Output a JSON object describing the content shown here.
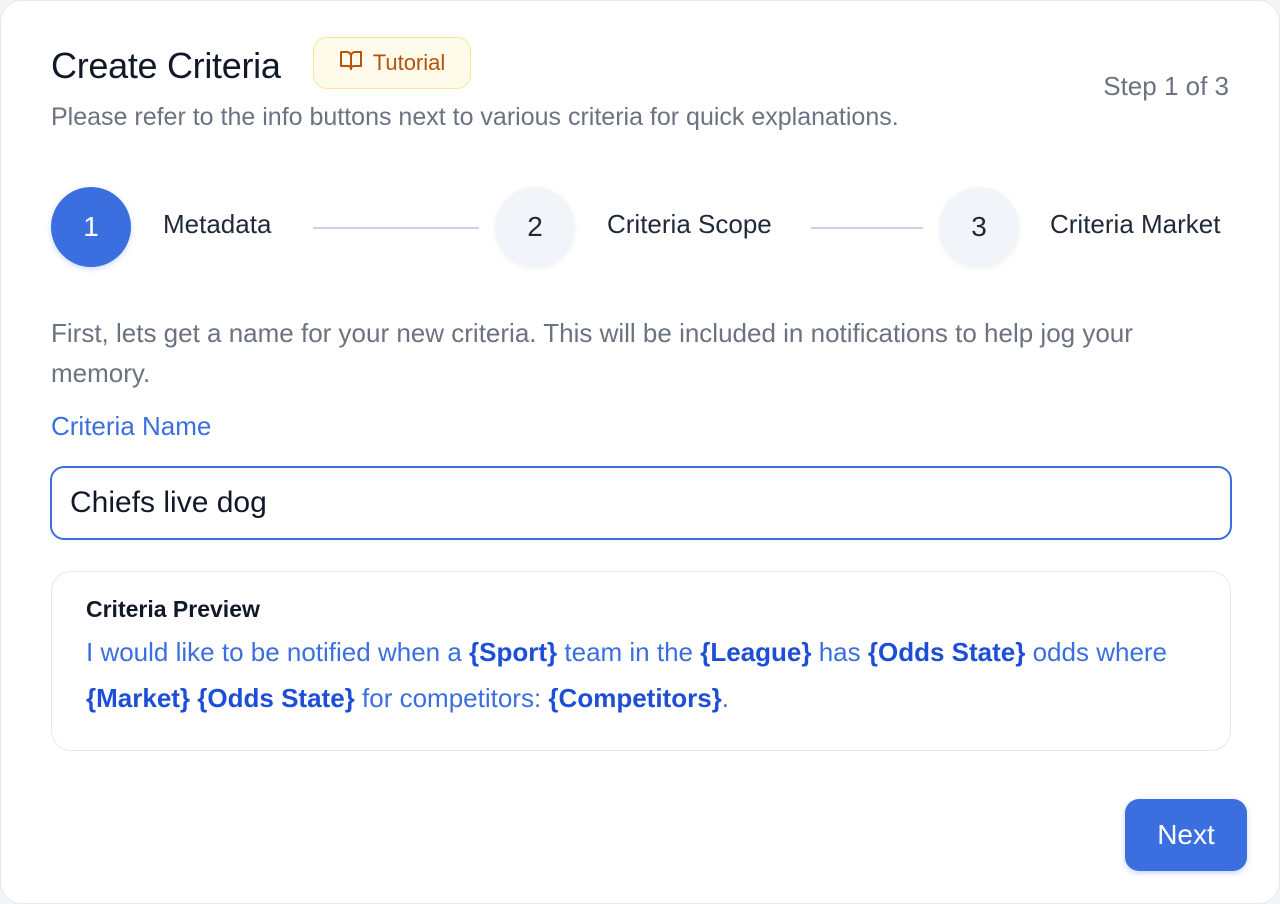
{
  "header": {
    "title": "Create Criteria",
    "tutorial_label": "Tutorial",
    "tutorial_icon": "book-open-icon",
    "step_indicator": "Step 1 of 3",
    "subtitle": "Please refer to the info buttons next to various criteria for quick explanations."
  },
  "stepper": {
    "steps": [
      {
        "number": "1",
        "label": "Metadata",
        "state": "active"
      },
      {
        "number": "2",
        "label": "Criteria Scope",
        "state": "inactive"
      },
      {
        "number": "3",
        "label": "Criteria Market",
        "state": "inactive"
      }
    ]
  },
  "form": {
    "intro": "First, lets get a name for your new criteria. This will be included in notifications to help jog your memory.",
    "name_label": "Criteria Name",
    "name_value": "Chiefs live dog"
  },
  "preview": {
    "title": "Criteria Preview",
    "segments": [
      {
        "text": "I would like to be notified when a ",
        "token": false
      },
      {
        "text": "{Sport}",
        "token": true
      },
      {
        "text": " team in the ",
        "token": false
      },
      {
        "text": "{League}",
        "token": true
      },
      {
        "text": " has ",
        "token": false
      },
      {
        "text": "{Odds State}",
        "token": true
      },
      {
        "text": " odds where ",
        "token": false
      },
      {
        "text": "{Market}",
        "token": true
      },
      {
        "text": " ",
        "token": false
      },
      {
        "text": "{Odds State}",
        "token": true
      },
      {
        "text": " for competitors: ",
        "token": false
      },
      {
        "text": "{Competitors}",
        "token": true
      },
      {
        "text": ".",
        "token": false
      }
    ]
  },
  "actions": {
    "next_label": "Next"
  },
  "colors": {
    "accent": "#3b6fe0",
    "token": "#1d4ed8",
    "tutorial_text": "#b45309",
    "tutorial_bg": "#fffbeb"
  }
}
